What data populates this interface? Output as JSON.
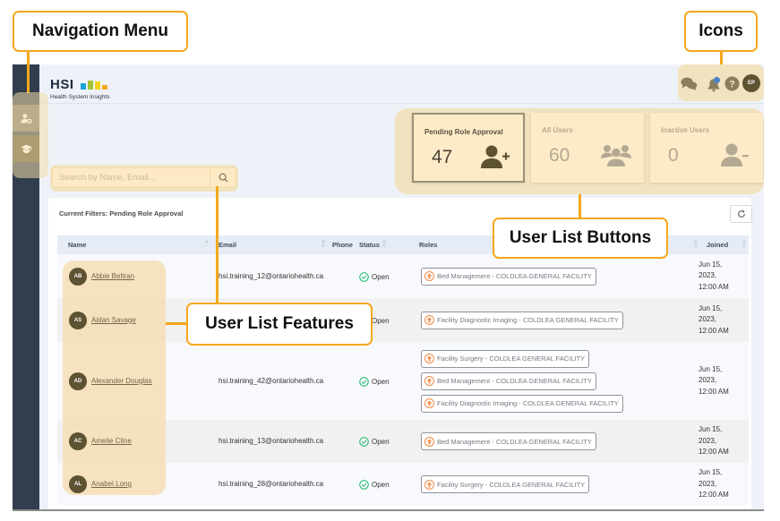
{
  "annotations": {
    "navigation_menu": "Navigation Menu",
    "icons": "Icons",
    "user_list_buttons": "User List Buttons",
    "user_list_features": "User List Features"
  },
  "header": {
    "logo_text": "HSI",
    "logo_subtitle": "Health System Insights",
    "logo_bar_colors": [
      "#1fa3dc",
      "#a4c235",
      "#f5d21a",
      "#f5a81c"
    ],
    "user_initials": "EP",
    "icons": [
      "chat-icon",
      "bell-icon",
      "help-icon",
      "avatar"
    ]
  },
  "sidebar": {
    "items": [
      {
        "icon": "user-settings-icon",
        "active": true
      },
      {
        "icon": "graduation-cap-icon",
        "active": false
      }
    ]
  },
  "stats": {
    "cards": [
      {
        "title": "Pending Role Approval",
        "value": "47",
        "icon": "user-plus-icon",
        "active": true
      },
      {
        "title": "All Users",
        "value": "60",
        "icon": "users-group-icon",
        "active": false
      },
      {
        "title": "Inactive Users",
        "value": "0",
        "icon": "user-minus-icon",
        "active": false
      }
    ]
  },
  "search": {
    "placeholder": "Search by Name, Email...",
    "value": ""
  },
  "table": {
    "current_filters": "Current Filters: Pending Role Approval",
    "columns": [
      "Name",
      "Email",
      "Phone",
      "Status",
      "Roles",
      "Joined"
    ],
    "rows": [
      {
        "initials": "AB",
        "name": "Abbie Beltran",
        "email": "hsi.training_12@ontariohealth.ca",
        "phone": "",
        "status": "Open",
        "roles": [
          "Bed Management - COLDLEA GENERAL FACILITY"
        ],
        "joined": [
          "Jun 15,",
          "2023,",
          "12:00 AM"
        ]
      },
      {
        "initials": "AS",
        "name": "Aidan Savage",
        "email": "",
        "phone": "",
        "status": "Open",
        "roles": [
          "Facility Diagnostic Imaging - COLDLEA GENERAL FACILITY"
        ],
        "joined": [
          "Jun 15,",
          "2023,",
          "12:00 AM"
        ]
      },
      {
        "initials": "AD",
        "name": "Alexander Douglas",
        "email": "hsi.training_42@ontariohealth.ca",
        "phone": "",
        "status": "Open",
        "roles": [
          "Facility Surgery - COLDLEA GENERAL FACILITY",
          "Bed Management - COLDLEA GENERAL FACILITY",
          "Facility Diagnostic Imaging - COLDLEA GENERAL FACILITY"
        ],
        "joined": [
          "Jun 15,",
          "2023,",
          "12:00 AM"
        ]
      },
      {
        "initials": "AC",
        "name": "Amelie Cline",
        "email": "hsi.training_13@ontariohealth.ca",
        "phone": "",
        "status": "Open",
        "roles": [
          "Bed Management - COLDLEA GENERAL FACILITY"
        ],
        "joined": [
          "Jun 15,",
          "2023,",
          "12:00 AM"
        ]
      },
      {
        "initials": "AL",
        "name": "Anabel Long",
        "email": "hsi.training_28@ontariohealth.ca",
        "phone": "",
        "status": "Open",
        "roles": [
          "Facility Surgery - COLDLEA GENERAL FACILITY"
        ],
        "joined": [
          "Jun 15,",
          "2023,",
          "12:00 AM"
        ]
      }
    ]
  },
  "colors": {
    "highlight": "#f1e3bf",
    "callout_border": "#f5a81c",
    "sidebar_bg": "#323d4e",
    "status_open": "#2cc07a",
    "role_icon": "#f08a44",
    "accent_brown": "#5d5232"
  }
}
